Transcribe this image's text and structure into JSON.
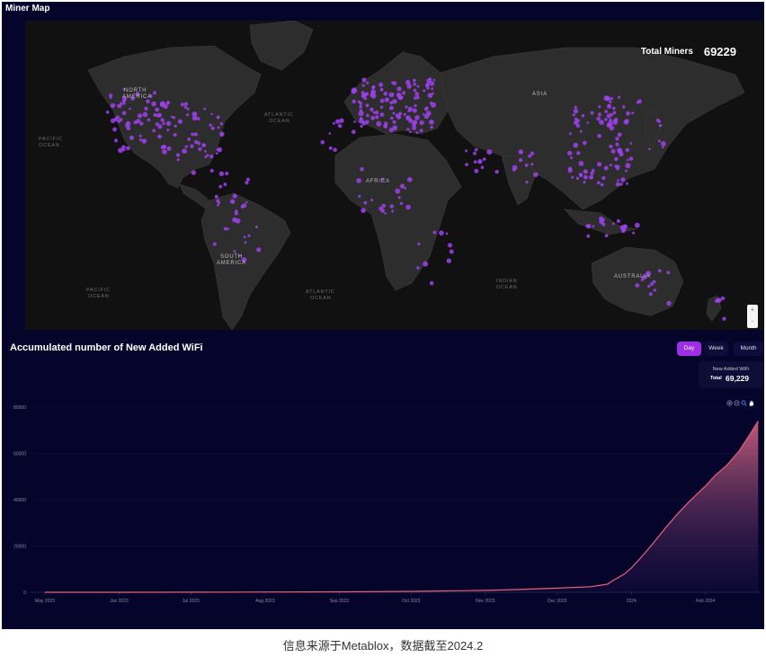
{
  "map": {
    "title": "Miner Map",
    "total_label": "Total Miners",
    "total_value": "69229",
    "ocean_labels": [
      "PACIFIC",
      "OCEAN",
      "ATLANTIC",
      "OCEAN",
      "PACIFIC",
      "OCEAN",
      "ATLANTIC",
      "OCEAN",
      "INDIAN",
      "OCEAN"
    ],
    "continent_labels": [
      "NORTH",
      "AMERICA",
      "SOUTH",
      "AMERICA",
      "AFRICA",
      "ASIA",
      "AUSTRALIA"
    ],
    "zoom_in": "+",
    "zoom_out": "-",
    "dot_color": "#a040f0"
  },
  "chart_panel": {
    "title": "Accumulated number of New Added WiFi",
    "range_buttons": [
      "Day",
      "Week",
      "Month"
    ],
    "selected_range": "Day",
    "tooltip": {
      "series": "New Added WiFi",
      "total_label": "Total",
      "total_value": "69,229"
    },
    "toolbox_icons": [
      "zoom-in-icon",
      "zoom-out-icon",
      "search-icon",
      "pan-hand-icon"
    ]
  },
  "chart_data": {
    "type": "area",
    "title": "Accumulated number of New Added WiFi",
    "x_tick_labels": [
      "May 2023",
      "Jun 2023",
      "Jul 2023",
      "Aug 2023",
      "Sep 2023",
      "Oct 2023",
      "Nov 2023",
      "Dec 2023",
      "2024",
      "Feb 2024"
    ],
    "y_tick_labels": [
      "0",
      "20000",
      "40000",
      "60000",
      "80000"
    ],
    "ylim": [
      0,
      80000
    ],
    "grid": true,
    "line_color": "#e8607a",
    "series": [
      {
        "x": [
          "2023-05-01",
          "2023-06-01",
          "2023-07-01",
          "2023-08-01",
          "2023-09-01",
          "2023-10-01",
          "2023-11-01",
          "2023-11-15",
          "2023-12-01",
          "2023-12-15",
          "2023-12-22",
          "2023-12-25",
          "2023-12-29",
          "2024-01-01",
          "2024-01-05",
          "2024-01-10",
          "2024-01-15",
          "2024-01-20",
          "2024-01-25",
          "2024-02-01",
          "2024-02-05",
          "2024-02-10",
          "2024-02-15",
          "2024-02-20",
          "2024-02-23"
        ],
        "values": [
          0,
          0,
          50,
          100,
          200,
          400,
          800,
          1200,
          1800,
          2400,
          3500,
          5500,
          7800,
          10500,
          15000,
          21000,
          27500,
          33500,
          39000,
          46000,
          50500,
          55000,
          61000,
          69000,
          74000
        ]
      }
    ]
  },
  "caption": "信息来源于Metablox，数据截至2024.2"
}
